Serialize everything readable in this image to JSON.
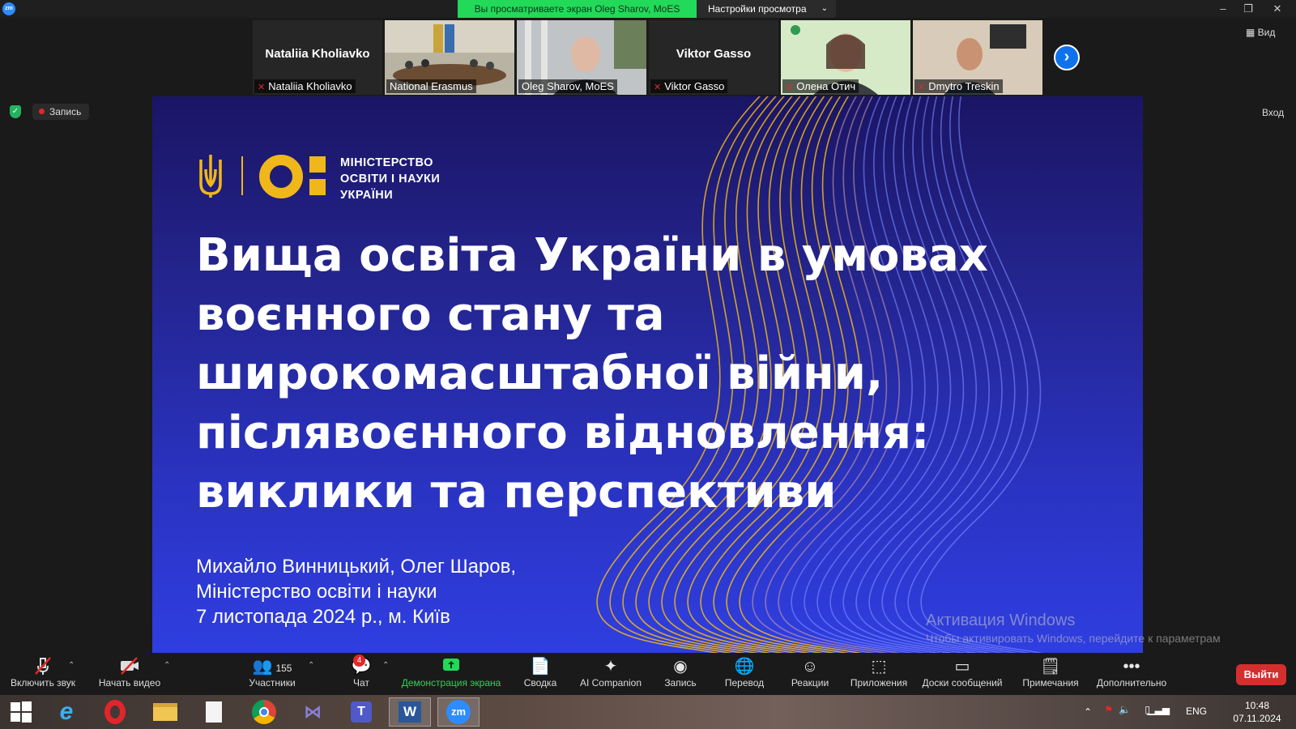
{
  "titlebar": {
    "app_icon": "zm",
    "share_banner": "Вы просматриваете экран Oleg Sharov, MoES",
    "view_options": "Настройки просмотра",
    "minimize_icon": "–",
    "restore_icon": "❐",
    "close_icon": "✕"
  },
  "gallery": {
    "tiles": [
      {
        "big_name": "Nataliia Kholiavko",
        "label": "Nataliia Kholiavko",
        "muted": true,
        "has_video": false
      },
      {
        "big_name": "",
        "label": "National Erasmus",
        "muted": false,
        "has_video": true
      },
      {
        "big_name": "",
        "label": "Oleg Sharov, MoES",
        "muted": false,
        "has_video": true
      },
      {
        "big_name": "Viktor Gasso",
        "label": "Viktor Gasso",
        "muted": true,
        "has_video": false
      },
      {
        "big_name": "",
        "label": "Олена Отич",
        "muted": true,
        "has_video": true
      },
      {
        "big_name": "",
        "label": "Dmytro Treskin",
        "muted": true,
        "has_video": true
      }
    ],
    "next_icon": "›"
  },
  "header_right": {
    "view": "Вид",
    "login": "Вход"
  },
  "recording": {
    "label": "Запись"
  },
  "slide": {
    "ministry_name": "МІНІСТЕРСТВО\nОСВІТИ І НАУКИ\nУКРАЇНИ",
    "title_lines": [
      "Вища освіта України в умовах",
      "воєнного стану та",
      "широкомасштабної війни,",
      "післявоєнного відновлення:",
      "виклики та перспективи"
    ],
    "authors": "Михайло Винницький, Олег Шаров,",
    "org": "Міністерство освіти і науки",
    "date_place": "7 листопада 2024 р., м. Київ"
  },
  "watermark": {
    "line1": "Активация Windows",
    "line2": "Чтобы активировать Windows, перейдите к параметрам компьютера."
  },
  "controls": {
    "audio": "Включить звук",
    "video": "Начать видео",
    "participants": "Участники",
    "participants_count": "155",
    "chat": "Чат",
    "chat_badge": "4",
    "share": "Демонстрация экрана",
    "summary": "Сводка",
    "ai": "AI Companion",
    "record": "Запись",
    "translate": "Перевод",
    "reactions": "Реакции",
    "apps": "Приложения",
    "whiteboards": "Доски сообщений",
    "notes": "Примечания",
    "more": "Дополнительно",
    "leave": "Выйти"
  },
  "taskbar": {
    "language": "ENG",
    "time": "10:48",
    "date": "07.11.2024"
  },
  "colors": {
    "accent_green": "#23d959",
    "brand_yellow": "#f0b71a",
    "zoom_blue": "#0e72ed",
    "leave_red": "#d32f2f"
  }
}
